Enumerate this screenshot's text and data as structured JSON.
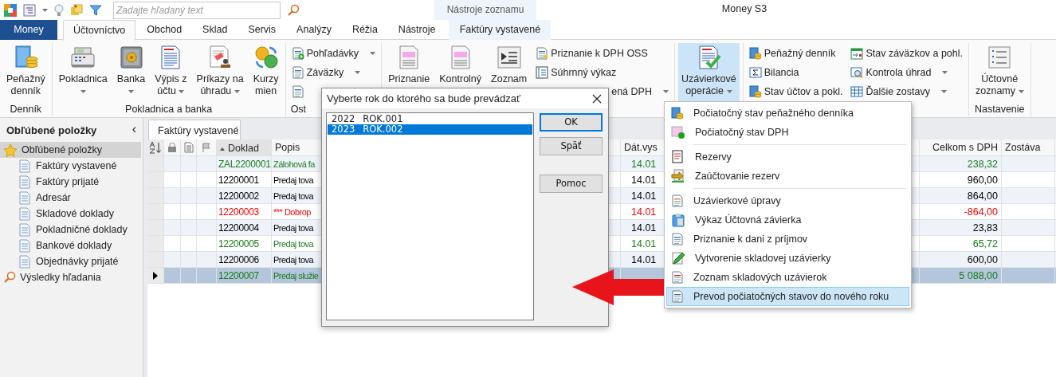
{
  "titlebar": {
    "search": {
      "placeholder": "Zadajte hľadaný text"
    },
    "contextual_header": "Nástroje zoznamu",
    "title": "Money S3"
  },
  "tabs": [
    {
      "label": "Money",
      "kind": "file",
      "selected": false
    },
    {
      "label": "Účtovníctvo",
      "kind": "tab",
      "selected": true
    },
    {
      "label": "Obchod",
      "kind": "tab",
      "selected": false
    },
    {
      "label": "Sklad",
      "kind": "tab",
      "selected": false
    },
    {
      "label": "Servis",
      "kind": "tab",
      "selected": false
    },
    {
      "label": "Analýzy",
      "kind": "tab",
      "selected": false
    },
    {
      "label": "Réžia",
      "kind": "tab",
      "selected": false
    },
    {
      "label": "Nástroje",
      "kind": "tab",
      "selected": false
    },
    {
      "label": "Faktúry vystavené",
      "kind": "contextual",
      "selected": false
    }
  ],
  "ribbon": {
    "groups": [
      {
        "label": "Denník",
        "items": [
          {
            "kind": "large",
            "lines": [
              "Peňažný",
              "denník"
            ],
            "dropdown": false
          }
        ]
      },
      {
        "label": "Pokladnica a banka",
        "items": [
          {
            "kind": "large",
            "lines": [
              "Pokladnica"
            ],
            "dropdown": true
          },
          {
            "kind": "large",
            "lines": [
              "Banka"
            ],
            "dropdown": true
          },
          {
            "kind": "large",
            "lines": [
              "Výpis z",
              "účtu"
            ],
            "dropdown": true
          },
          {
            "kind": "large",
            "lines": [
              "Príkazy na",
              "úhradu"
            ],
            "dropdown": true
          },
          {
            "kind": "large",
            "lines": [
              "Kurzy",
              "mien"
            ],
            "dropdown": false
          }
        ]
      },
      {
        "label": "Ost",
        "items": [
          {
            "kind": "small",
            "label": "Pohľadávky",
            "dropdown": true
          },
          {
            "kind": "small",
            "label": "Záväzky",
            "dropdown": true
          },
          {
            "kind": "small",
            "dropdown": false
          }
        ]
      },
      {
        "items": [
          {
            "kind": "large",
            "lines": [
              "Priznanie"
            ],
            "dropdown": false
          },
          {
            "kind": "large",
            "lines": [
              "Kontrolný"
            ],
            "dropdown": false
          },
          {
            "kind": "large",
            "lines": [
              "Zoznam"
            ],
            "dropdown": false
          },
          {
            "kind": "small",
            "label": "Priznanie k DPH OSS",
            "dropdown": false
          },
          {
            "kind": "small",
            "label": "Súhrnný výkaz",
            "dropdown": false
          },
          {
            "kind": "small",
            "label": "ená DPH",
            "dropdown": true
          }
        ]
      },
      {
        "items": [
          {
            "kind": "large",
            "lines": [
              "Uzávierkové",
              "operácie"
            ],
            "dropdown": true,
            "expanded": true
          }
        ]
      },
      {
        "items": [
          {
            "kind": "small",
            "label": "Peňažný denník",
            "dropdown": false
          },
          {
            "kind": "small",
            "label": "Bilancia",
            "dropdown": false
          },
          {
            "kind": "small",
            "label": "Stav účtov a pokl.",
            "dropdown": false
          },
          {
            "kind": "small",
            "label": "Stav záväzkov a pohl.",
            "dropdown": false
          },
          {
            "kind": "small",
            "label": "Kontrola úhrad",
            "dropdown": true
          },
          {
            "kind": "small",
            "label": "Ďalšie zostavy",
            "dropdown": true
          }
        ]
      },
      {
        "label": "Nastavenie",
        "items": [
          {
            "kind": "large",
            "lines": [
              "Účtovné",
              "zoznamy"
            ],
            "dropdown": true
          }
        ]
      }
    ]
  },
  "sidebar": {
    "title": "Obľúbené položky",
    "collapse": "‹",
    "items": [
      {
        "label": "Obľúbené položky",
        "kind": "favorites",
        "selected": true,
        "children": [
          {
            "label": "Faktúry vystavené",
            "selected": false
          },
          {
            "label": "Faktúry prijaté",
            "selected": false
          },
          {
            "label": "Adresár",
            "selected": false
          },
          {
            "label": "Skladové doklady",
            "selected": false
          },
          {
            "label": "Pokladničné doklady",
            "selected": false
          },
          {
            "label": "Bankové doklady",
            "selected": false
          },
          {
            "label": "Objednávky prijaté",
            "selected": false
          }
        ]
      },
      {
        "label": "Výsledky hľadania",
        "kind": "search",
        "selected": false
      }
    ]
  },
  "document_tab": "Faktúry vystavené",
  "table": {
    "columns": [
      "Doklad",
      "Popis",
      "Dát.vys",
      "Celkom s DPH",
      "Zostáva"
    ],
    "rows": [
      {
        "doklad": "ZAL2200001",
        "popis": "Zálohová fa",
        "date": "14.01",
        "total": "238,32",
        "color": "#1a7a1a",
        "selected": false
      },
      {
        "doklad": "12200001",
        "popis": "Predaj tova",
        "date": "14.01",
        "total": "960,00",
        "color": "#000000",
        "selected": false
      },
      {
        "doklad": "12200002",
        "popis": "Predaj tova",
        "date": "14.01",
        "total": "864,00",
        "color": "#000000",
        "selected": false
      },
      {
        "doklad": "12200003",
        "popis": "*** Dobrop",
        "date": "14.01",
        "total": "-864,00",
        "color": "#ff0000",
        "selected": false
      },
      {
        "doklad": "12200004",
        "popis": "Predaj tova",
        "date": "14.01",
        "total": "23,83",
        "color": "#000000",
        "selected": false
      },
      {
        "doklad": "12200005",
        "popis": "Predaj tova",
        "date": "14.01",
        "total": "65,72",
        "color": "#1a7a1a",
        "selected": false
      },
      {
        "doklad": "12200006",
        "popis": "Predaj tova",
        "date": "14.01",
        "total": "600,00",
        "color": "#000000",
        "selected": false
      },
      {
        "doklad": "12200007",
        "popis": "Predaj služie",
        "total": "5 088,00",
        "color": "#1a7a1a",
        "selected": true
      }
    ]
  },
  "dialog": {
    "title": "Vyberte rok do ktorého sa bude prevádzať",
    "items": [
      {
        "year": "2022",
        "name": "ROK.001",
        "selected": false
      },
      {
        "year": "2023",
        "name": "ROK.002",
        "selected": true
      }
    ],
    "buttons": [
      {
        "label": "OK",
        "default": true
      },
      {
        "label": "Späť",
        "default": false
      },
      {
        "label": "Pomoc",
        "default": false
      }
    ]
  },
  "menu": {
    "sections": [
      [
        {
          "label": "Počiatočný stav peňažného denníka",
          "selected": false
        },
        {
          "label": "Počiatočný stav DPH",
          "selected": false
        }
      ],
      [
        {
          "label": "Rezervy",
          "selected": false
        },
        {
          "label": "Zaúčtovanie rezerv",
          "selected": false
        }
      ],
      [
        {
          "label": "Uzávierkové úpravy",
          "selected": false
        },
        {
          "label": "Výkaz Účtovná závierka",
          "selected": false
        },
        {
          "label": "Priznanie k dani z príjmov",
          "selected": false
        },
        {
          "label": "Vytvorenie skladovej uzávierky",
          "selected": false
        },
        {
          "label": "Zoznam skladových uzávierok",
          "selected": false
        },
        {
          "label": "Prevod počiatočných stavov do nového roku",
          "selected": true
        }
      ]
    ]
  }
}
